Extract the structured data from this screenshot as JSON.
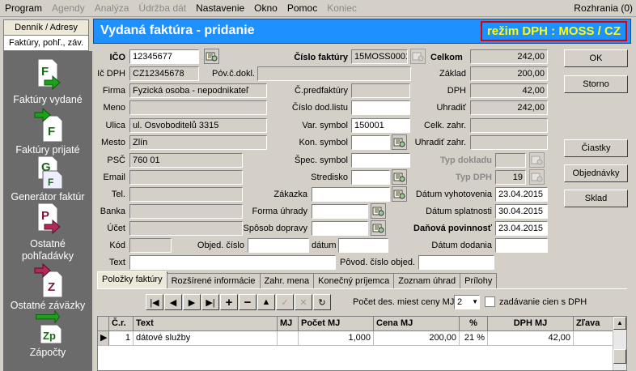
{
  "menu": {
    "items": [
      {
        "label": "Program",
        "disabled": false
      },
      {
        "label": "Agendy",
        "disabled": true
      },
      {
        "label": "Analýza",
        "disabled": true
      },
      {
        "label": "Údržba dát",
        "disabled": true
      },
      {
        "label": "Nastavenie",
        "disabled": false
      },
      {
        "label": "Okno",
        "disabled": false
      },
      {
        "label": "Pomoc",
        "disabled": false
      },
      {
        "label": "Koniec",
        "disabled": true
      }
    ],
    "right": "Rozhrania (0)"
  },
  "side": {
    "tabs": [
      "Denník / Adresy",
      "Faktúry, pohľ., záv."
    ],
    "items": [
      {
        "label": "Faktúry vydané",
        "letter": "F",
        "icon": "invoice-issued-icon"
      },
      {
        "label": "Faktúry prijaté",
        "letter": "F",
        "icon": "invoice-received-icon"
      },
      {
        "label": "Generátor faktúr",
        "letter": "G",
        "icon": "invoice-generator-icon"
      },
      {
        "label": "Ostatné pohľadávky",
        "letter": "P",
        "icon": "receivables-icon"
      },
      {
        "label": "Ostatné záväzky",
        "letter": "Z",
        "icon": "liabilities-icon"
      },
      {
        "label": "Zápočty",
        "letter": "Zp",
        "icon": "offsets-icon"
      }
    ]
  },
  "header": {
    "title": "Vydaná faktúra  -  pridanie",
    "mode": "režim DPH : MOSS / CZ"
  },
  "form": {
    "ico_label": "IČO",
    "ico": "12345677",
    "icdph_label": "Ič DPH",
    "icdph": "CZ12345678",
    "firma_label": "Firma",
    "firma": "Fyzická osoba - nepodnikateľ",
    "meno_label": "Meno",
    "meno": "",
    "ulica_label": "Ulica",
    "ulica": "ul. Osvoboditelů 3315",
    "mesto_label": "Mesto",
    "mesto": "Zlín",
    "psc_label": "PSČ",
    "psc": "760 01",
    "email_label": "Email",
    "email": "",
    "tel_label": "Tel.",
    "tel": "",
    "banka_label": "Banka",
    "banka": "",
    "ucet_label": "Účet",
    "ucet": "",
    "kod_label": "Kód",
    "kod": "",
    "text_label": "Text",
    "text": "",
    "cislo_faktury_label": "Číslo faktúry",
    "cislo_faktury": "15MOSS0001",
    "pov_doklad_label": "Póv.č.dokl.",
    "c_predfaktury_label": "Č.predfaktúry",
    "cislo_dod_listu_label": "Číslo dod.listu",
    "var_symbol_label": "Var. symbol",
    "var_symbol": "150001",
    "kon_symbol_label": "Kon. symbol",
    "spec_symbol_label": "Špec. symbol",
    "stredisko_label": "Stredisko",
    "zakazka_label": "Zákazka",
    "forma_uhrady_label": "Forma úhrady",
    "sposob_dopravy_label": "Spôsob dopravy",
    "obj_cislo_label": "Objed. číslo",
    "datum_label": "dátum",
    "povod_cislo_obj_label": "Pôvod. číslo objed.",
    "celkom_label": "Celkom",
    "celkom": "242,00",
    "zaklad_label": "Základ",
    "zaklad": "200,00",
    "dph_label": "DPH",
    "dph": "42,00",
    "uhradit_label": "Uhradiť",
    "uhradit": "242,00",
    "celk_zahr_label": "Celk. zahr.",
    "uhradit_zahr_label": "Uhradiť zahr.",
    "typ_dokladu_label": "Typ dokladu",
    "typ_dph_label": "Typ DPH",
    "typ_dph": "19",
    "datum_vyhotovenia_label": "Dátum vyhotovenia",
    "datum_vyhotovenia": "23.04.2015",
    "datum_splatnosti_label": "Dátum splatnosti",
    "datum_splatnosti": "30.04.2015",
    "danova_povinnost_label": "Daňová povinnosť",
    "danova_povinnost": "23.04.2015",
    "datum_dodania_label": "Dátum  dodania"
  },
  "buttons": {
    "ok": "OK",
    "storno": "Storno",
    "ciastky": "Čiastky",
    "objednavky": "Objednávky",
    "sklad": "Sklad"
  },
  "tabs": [
    "Položky faktúry",
    "Rozšírené informácie",
    "Zahr. mena",
    "Konečný príjemca",
    "Zoznam úhrad",
    "Prílohy"
  ],
  "toolbar": {
    "decimals_label": "Počet des. miest ceny MJ",
    "decimals": "2",
    "vat_prices_label": "zadávanie cien s DPH"
  },
  "grid": {
    "columns": [
      "Č.r.",
      "Text",
      "MJ",
      "Počet MJ",
      "Cena MJ",
      "%",
      "DPH MJ",
      "Zľava"
    ],
    "rows": [
      [
        "1",
        "dátové služby",
        "",
        "1,000",
        "200,00",
        "21 %",
        "42,00",
        ""
      ]
    ]
  }
}
